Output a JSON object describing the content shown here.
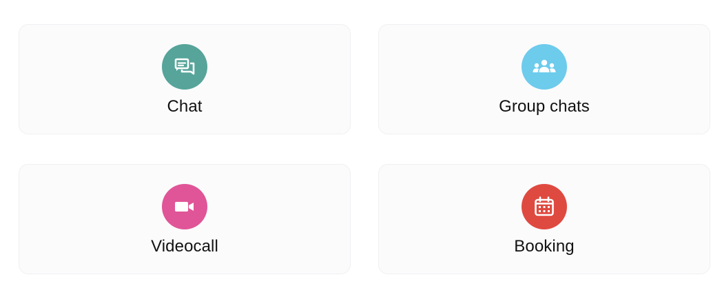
{
  "cards": [
    {
      "label": "Chat",
      "icon": "chat-bubbles-icon",
      "color": "#56A49A"
    },
    {
      "label": "Group chats",
      "icon": "group-users-icon",
      "color": "#6DCBEC"
    },
    {
      "label": "Videocall",
      "icon": "video-camera-icon",
      "color": "#E05597"
    },
    {
      "label": "Booking",
      "icon": "calendar-icon",
      "color": "#DF4A40"
    }
  ]
}
